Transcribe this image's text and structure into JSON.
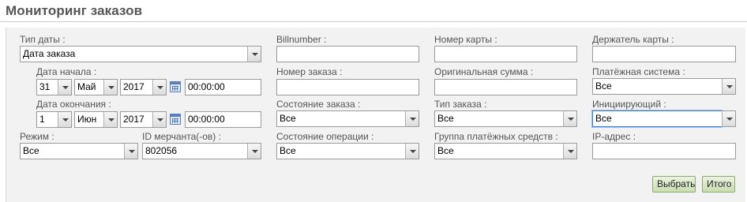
{
  "page": {
    "title": "Мониторинг заказов"
  },
  "form": {
    "date_type": {
      "label": "Тип даты :",
      "value": "Дата заказа"
    },
    "date_start": {
      "label": "Дата начала :",
      "day": "31",
      "month": "Май",
      "year": "2017",
      "time": "00:00:00"
    },
    "date_end": {
      "label": "Дата окончания :",
      "day": "1",
      "month": "Июн",
      "year": "2017",
      "time": "00:00:00"
    },
    "mode": {
      "label": "Режим :",
      "value": "Все"
    },
    "merchant_id": {
      "label": "ID мерчанта(-ов) :",
      "value": "802056"
    },
    "billnumber": {
      "label": "Billnumber :",
      "value": ""
    },
    "order_number": {
      "label": "Номер заказа :",
      "value": ""
    },
    "order_state": {
      "label": "Состояние заказа :",
      "value": "Все"
    },
    "operation_state": {
      "label": "Состояние операции :",
      "value": "Все"
    },
    "card_number": {
      "label": "Номер карты :",
      "value": ""
    },
    "original_amount": {
      "label": "Оригинальная сумма :",
      "value": ""
    },
    "order_type": {
      "label": "Тип заказа :",
      "value": "Все"
    },
    "payment_group": {
      "label": "Группа платёжных средств :",
      "value": "Все"
    },
    "card_holder": {
      "label": "Держатель карты :",
      "value": ""
    },
    "payment_system": {
      "label": "Платёжная система :",
      "value": "Все"
    },
    "initiator": {
      "label": "Инициирующий :",
      "value": "Все"
    },
    "ip_address": {
      "label": "IP-адрес :",
      "value": ""
    }
  },
  "buttons": {
    "select": "Выбрать",
    "total": "Итого"
  }
}
